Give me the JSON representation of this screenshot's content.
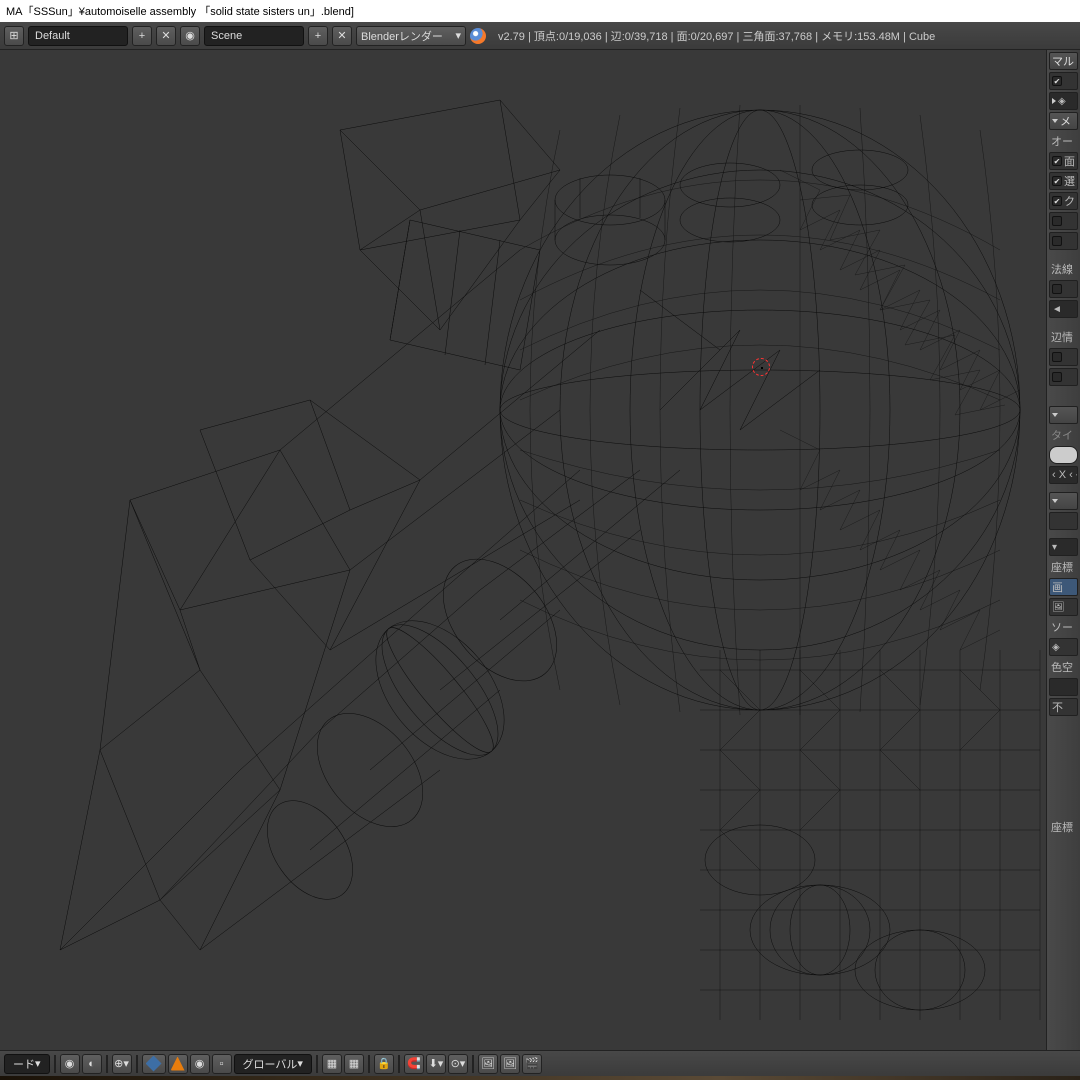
{
  "window": {
    "title": "MA「SSSun」¥automoiselle assembly 「solid state  sisters un」.blend]"
  },
  "header": {
    "layout": "Default",
    "scene": "Scene",
    "renderer": "Blenderレンダー",
    "version": "v2.79",
    "stats": "頂点:0/19,036 | 辺:0/39,718 | 面:0/20,697 | 三角面:37,768 | メモリ:153.48M | Cube"
  },
  "panel": {
    "h1": "マル",
    "h2": "メ",
    "auto": "オー",
    "p1": "面",
    "p2": "選",
    "p3": "ク",
    "h3": "法線",
    "h4": "辺情",
    "h5": "タイ",
    "xyz": "‹ X ‹ ‹",
    "h6": "座標",
    "h7": "画",
    "h8": "ソー",
    "h9": "色空",
    "h10": "不",
    "h11": "座標"
  },
  "footer": {
    "mode": "ード",
    "orient": "グローバル"
  }
}
